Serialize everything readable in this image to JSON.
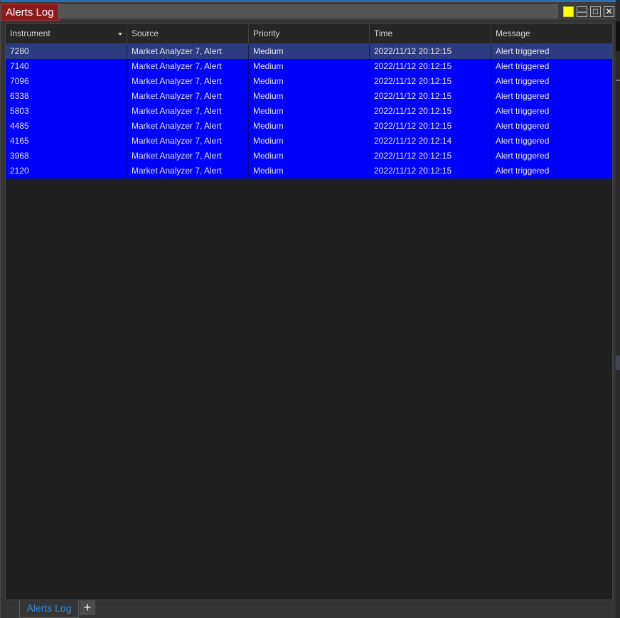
{
  "window": {
    "title": "Alerts Log",
    "accent_color": "#8b1a1a",
    "buttons": {
      "minimize": "—",
      "maximize": "□",
      "close": "✕"
    }
  },
  "grid": {
    "columns": [
      {
        "label": "Instrument",
        "sorted": "descending"
      },
      {
        "label": "Source"
      },
      {
        "label": "Priority"
      },
      {
        "label": "Time"
      },
      {
        "label": "Message"
      }
    ],
    "rows": [
      {
        "instrument": "7280",
        "source": "Market Analyzer 7, Alert",
        "priority": "Medium",
        "time": "2022/11/12 20:12:15",
        "message": "Alert triggered",
        "selected": true
      },
      {
        "instrument": "7140",
        "source": "Market Analyzer 7, Alert",
        "priority": "Medium",
        "time": "2022/11/12 20:12:15",
        "message": "Alert triggered"
      },
      {
        "instrument": "7096",
        "source": "Market Analyzer 7, Alert",
        "priority": "Medium",
        "time": "2022/11/12 20:12:15",
        "message": "Alert triggered"
      },
      {
        "instrument": "6338",
        "source": "Market Analyzer 7, Alert",
        "priority": "Medium",
        "time": "2022/11/12 20:12:15",
        "message": "Alert triggered"
      },
      {
        "instrument": "5803",
        "source": "Market Analyzer 7, Alert",
        "priority": "Medium",
        "time": "2022/11/12 20:12:15",
        "message": "Alert triggered"
      },
      {
        "instrument": "4485",
        "source": "Market Analyzer 7, Alert",
        "priority": "Medium",
        "time": "2022/11/12 20:12:15",
        "message": "Alert triggered"
      },
      {
        "instrument": "4165",
        "source": "Market Analyzer 7, Alert",
        "priority": "Medium",
        "time": "2022/11/12 20:12:14",
        "message": "Alert triggered"
      },
      {
        "instrument": "3968",
        "source": "Market Analyzer 7, Alert",
        "priority": "Medium",
        "time": "2022/11/12 20:12:15",
        "message": "Alert triggered"
      },
      {
        "instrument": "2120",
        "source": "Market Analyzer 7, Alert",
        "priority": "Medium",
        "time": "2022/11/12 20:12:15",
        "message": "Alert triggered"
      }
    ],
    "row_color": "#0000ff",
    "selected_row_color": "#2d3b80"
  },
  "tabs": {
    "items": [
      {
        "label": "Alerts Log",
        "active": true
      }
    ],
    "add_label": "+"
  }
}
